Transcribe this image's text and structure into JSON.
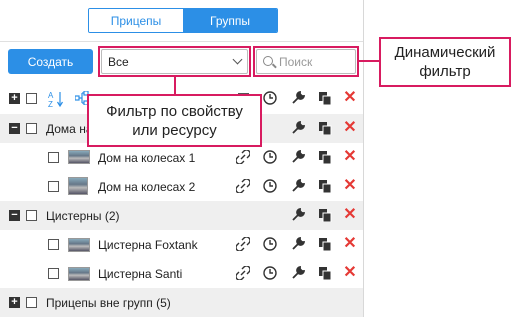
{
  "tabs": [
    {
      "label": "Прицепы",
      "active": false
    },
    {
      "label": "Группы",
      "active": true
    }
  ],
  "toolbar": {
    "create_label": "Создать",
    "filter_value": "Все",
    "search_placeholder": "Поиск"
  },
  "rows": [
    {
      "type": "group",
      "label": "Дома на",
      "expanded": true
    },
    {
      "type": "item",
      "label": "Дом на колесах 1"
    },
    {
      "type": "item",
      "label": "Дом на колесах 2"
    },
    {
      "type": "group",
      "label": "Цистерны (2)",
      "expanded": true
    },
    {
      "type": "item",
      "label": "Цистерна Foxtank"
    },
    {
      "type": "item",
      "label": "Цистерна Santi"
    },
    {
      "type": "group",
      "label": "Прицепы вне групп (5)",
      "expanded": false
    }
  ],
  "header_sort_icon": "A-Z sort-icon",
  "callouts": {
    "filter_by_property": "Фильтр по свойству или ресурсу",
    "dynamic_filter": "Динамический фильтр"
  },
  "colors": {
    "accent": "#2c8fe6",
    "callout": "#d81b60",
    "delete": "#e53935"
  }
}
